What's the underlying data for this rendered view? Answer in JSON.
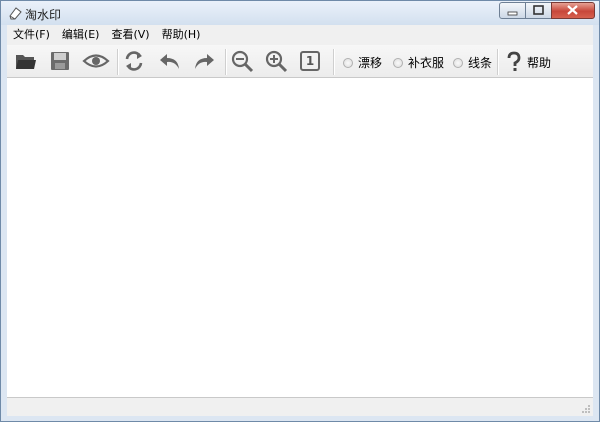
{
  "window": {
    "title": "淘水印"
  },
  "menu": [
    {
      "label": "文件(F)"
    },
    {
      "label": "编辑(E)"
    },
    {
      "label": "查看(V)"
    },
    {
      "label": "帮助(H)"
    }
  ],
  "toolbar": {
    "icons": [
      "folder-open-icon",
      "save-icon",
      "eye-icon",
      "refresh-icon",
      "undo-icon",
      "redo-icon",
      "zoom-out-icon",
      "zoom-in-icon",
      "actual-size-icon"
    ],
    "actual_size_text": "1",
    "modes": [
      {
        "label": "漂移",
        "selected": false
      },
      {
        "label": "补衣服",
        "selected": false
      },
      {
        "label": "线条",
        "selected": false
      }
    ],
    "help_label": "帮助"
  },
  "colors": {
    "icon_gray": "#666666",
    "frame": "#dce6f2"
  }
}
